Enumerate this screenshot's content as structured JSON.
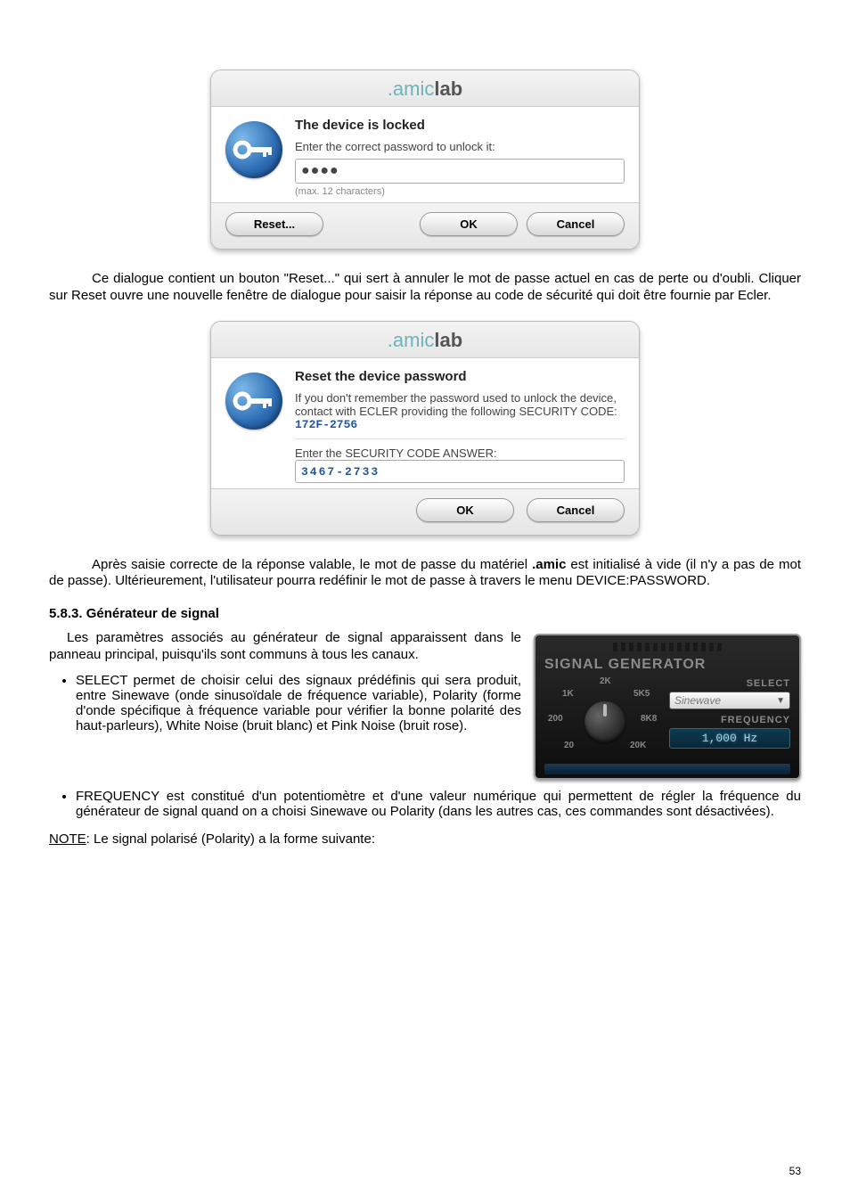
{
  "page_number": "53",
  "dialog1": {
    "brand_amic": ".amic",
    "brand_lab": "lab",
    "heading": "The device is locked",
    "instruction": "Enter the correct password to unlock it:",
    "password_mask": "●●●●",
    "hint": "(max. 12 characters)",
    "reset_btn": "Reset...",
    "ok_btn": "OK",
    "cancel_btn": "Cancel"
  },
  "para1": "Ce dialogue contient un bouton \"Reset...\" qui sert à annuler le mot de passe actuel en cas de perte ou d'oubli. Cliquer sur Reset ouvre une nouvelle fenêtre de dialogue pour saisir la réponse au code de sécurité qui doit être fournie par Ecler.",
  "dialog2": {
    "brand_amic": ".amic",
    "brand_lab": "lab",
    "heading": "Reset the device password",
    "instruction": "If you don't remember the password used to unlock the device, contact with ECLER providing the following SECURITY CODE:",
    "security_code": "172F-2756",
    "answer_label": "Enter the SECURITY CODE ANSWER:",
    "answer_value": "3467-2733",
    "ok_btn": "OK",
    "cancel_btn": "Cancel"
  },
  "para2_prefix": "Après saisie correcte de la réponse valable, le mot de passe du matériel ",
  "para2_bold": ".amic",
  "para2_suffix": " est initialisé à vide (il n'y a pas de mot de passe). Ultérieurement, l'utilisateur pourra redéfinir le mot de passe à travers le menu DEVICE:PASSWORD.",
  "section_heading": "5.8.3. Générateur de signal",
  "para3": "Les paramètres associés au générateur de signal apparaissent dans le panneau principal, puisqu'ils sont communs à tous les canaux.",
  "bullet1": "SELECT permet de choisir celui des signaux prédéfinis qui sera produit, entre Sinewave (onde sinusoïdale de fréquence variable), Polarity (forme d'onde spécifique à fréquence variable pour vérifier la bonne polarité des haut-parleurs), White Noise (bruit blanc) et Pink Noise (bruit rose).",
  "bullet2": "FREQUENCY est constitué d'un potentiomètre et d'une valeur numérique qui permettent de régler la fréquence du générateur de signal quand on a choisi Sinewave ou Polarity (dans les autres cas, ces commandes sont désactivées).",
  "note_label": "NOTE",
  "note_text": ": Le signal polarisé (Polarity) a la forme suivante:",
  "signal_generator": {
    "title": "SIGNAL GENERATOR",
    "ticks": {
      "t2k": "2K",
      "t1k": "1K",
      "t5k5": "5K5",
      "t200": "200",
      "t8k8": "8K8",
      "t20": "20",
      "t20k": "20K"
    },
    "select_label": "SELECT",
    "select_value": "Sinewave",
    "freq_label": "FREQUENCY",
    "freq_value": "1,000 Hz"
  }
}
